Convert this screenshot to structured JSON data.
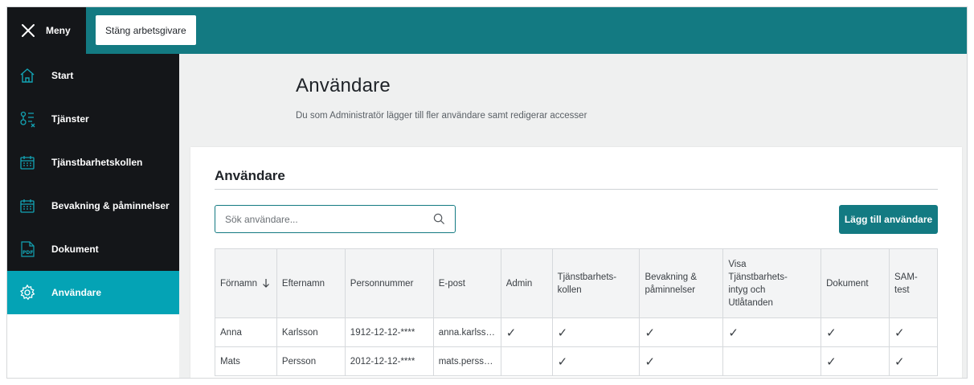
{
  "topbar": {
    "menu_label": "Meny",
    "close_employer_label": "Stäng arbetsgivare"
  },
  "sidebar": {
    "items": [
      {
        "label": "Start",
        "icon": "home-icon"
      },
      {
        "label": "Tjänster",
        "icon": "services-icon"
      },
      {
        "label": "Tjänstbarhetskollen",
        "icon": "calendar-icon"
      },
      {
        "label": "Bevakning & påminnelser",
        "icon": "calendar-icon"
      },
      {
        "label": "Dokument",
        "icon": "pdf-icon"
      },
      {
        "label": "Användare",
        "icon": "gear-icon",
        "active": true
      }
    ]
  },
  "page": {
    "title": "Användare",
    "subtitle": "Du som Administratör lägger till fler användare samt redigerar accesser"
  },
  "card": {
    "title": "Användare",
    "search_placeholder": "Sök användare...",
    "add_button_label": "Lägg till användare"
  },
  "table": {
    "headers": [
      "Förnamn",
      "Efternamn",
      "Personnummer",
      "E-post",
      "Admin",
      "Tjänstbarhets-kollen",
      "Bevakning & påminnelser",
      "Visa Tjänstbarhets-intyg och Utlåtanden",
      "Dokument",
      "SAM-test"
    ],
    "header_lines": [
      [
        "Förnamn"
      ],
      [
        "Efternamn"
      ],
      [
        "Personnummer"
      ],
      [
        "E-post"
      ],
      [
        "Admin"
      ],
      [
        "Tjänstbarhets-",
        "kollen"
      ],
      [
        "Bevakning &",
        "påminnelser"
      ],
      [
        "Visa",
        "Tjänstbarhets-",
        "intyg och",
        "Utlåtanden"
      ],
      [
        "Dokument"
      ],
      [
        "SAM-",
        "test"
      ]
    ],
    "check_glyph": "✓",
    "rows": [
      {
        "first_name": "Anna",
        "last_name": "Karlsson",
        "personal_number": "1912-12-12-****",
        "email": "anna.karlsson@…",
        "email_display": "anna.karlss…",
        "admin": true,
        "tjanstbarhetskollen": true,
        "bevakning": true,
        "intyg": true,
        "dokument": true,
        "sam_test": true
      },
      {
        "first_name": "Mats",
        "last_name": "Persson",
        "personal_number": "2012-12-12-****",
        "email": "mats.persson@…",
        "email_display": "mats.perss…",
        "admin": false,
        "tjanstbarhetskollen": true,
        "bevakning": true,
        "intyg": false,
        "dokument": true,
        "sam_test": true
      }
    ]
  },
  "colors": {
    "brand_teal": "#137a82",
    "active_nav": "#04a3b5",
    "dark_nav": "#141619"
  }
}
